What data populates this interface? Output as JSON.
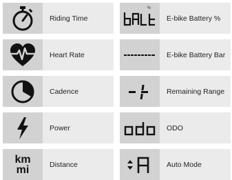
{
  "items": [
    {
      "label": "Riding Time"
    },
    {
      "label": "E-bike Battery %"
    },
    {
      "label": "Heart Rate"
    },
    {
      "label": "E-bike Battery Bar"
    },
    {
      "label": "Cadence"
    },
    {
      "label": "Remaining Range"
    },
    {
      "label": "Power"
    },
    {
      "label": "ODO"
    },
    {
      "label": "Distance"
    },
    {
      "label": "Auto Mode"
    }
  ],
  "icon_texts": {
    "percent_sign": "%",
    "distance_top": "km",
    "distance_bottom": "mi"
  }
}
